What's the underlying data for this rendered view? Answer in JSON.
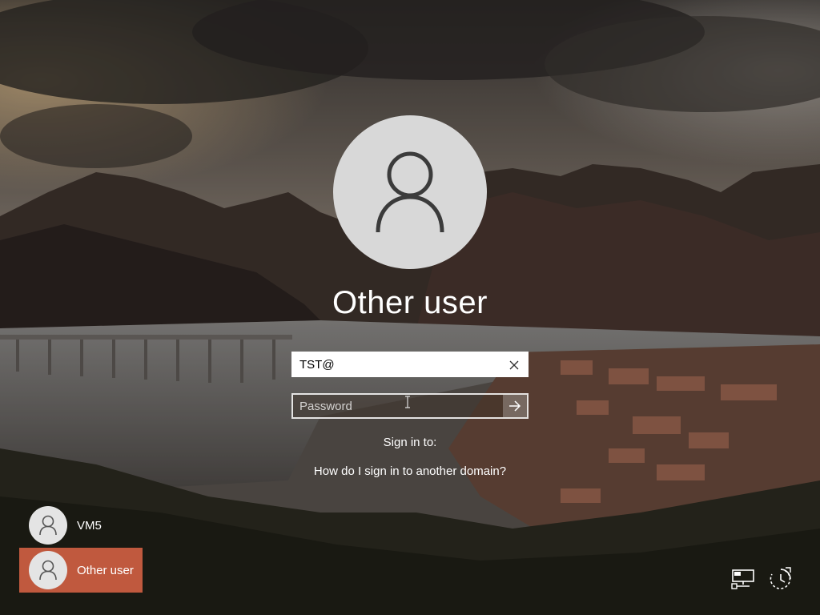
{
  "login": {
    "display_name": "Other user",
    "username_value": "TST@",
    "password_placeholder": "Password",
    "sign_in_to_label": "Sign in to:",
    "domain_help_link": "How do I sign in to another domain?"
  },
  "users": [
    {
      "name": "VM5",
      "selected": false
    },
    {
      "name": "Other user",
      "selected": true
    }
  ],
  "icons": {
    "avatar": "user-silhouette-icon",
    "clear": "close-icon",
    "submit": "arrow-right-icon",
    "network": "network-icon",
    "accessibility": "ease-of-access-icon",
    "power": "power-icon"
  },
  "colors": {
    "selected_tile": "#c0593e",
    "avatar_bg": "#d8d8d8",
    "text": "#ffffff"
  }
}
